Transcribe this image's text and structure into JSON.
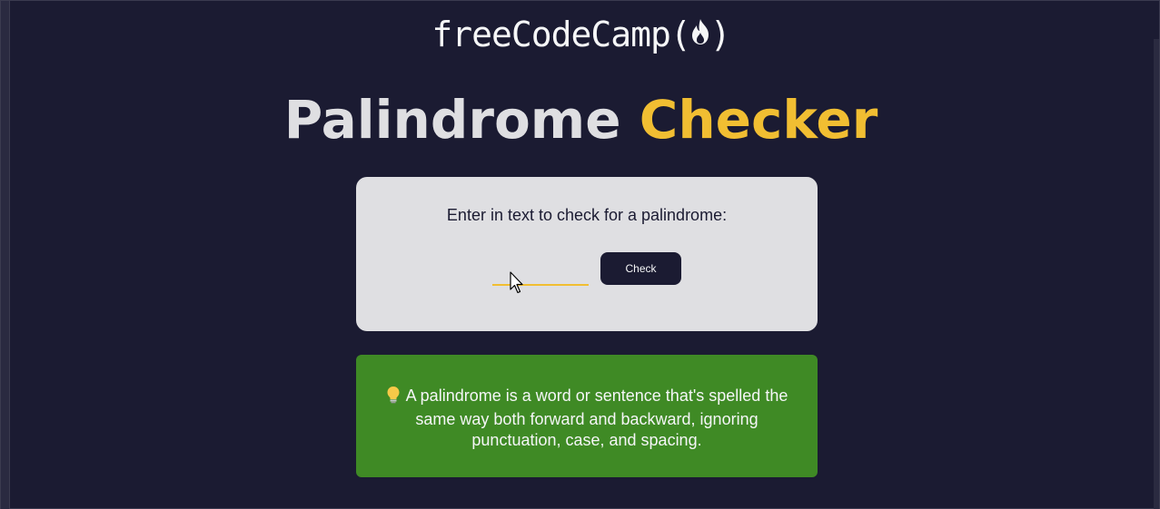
{
  "logo": {
    "text_before": "freeCodeCamp(",
    "text_after": ")",
    "icon": "flame-icon"
  },
  "title": {
    "part1": "Palindrome",
    "part2": "Checker"
  },
  "checker": {
    "label": "Enter in text to check for a palindrome:",
    "input_value": "",
    "button_label": "Check"
  },
  "info": {
    "icon": "lightbulb-icon",
    "text": "A palindrome is a word or sentence that's spelled the same way both forward and backward, ignoring punctuation, case, and spacing."
  },
  "colors": {
    "background": "#1b1b32",
    "card": "#dfdfe2",
    "accent": "#f1be32",
    "info": "#3f8a25",
    "button": "#1b1b32"
  }
}
